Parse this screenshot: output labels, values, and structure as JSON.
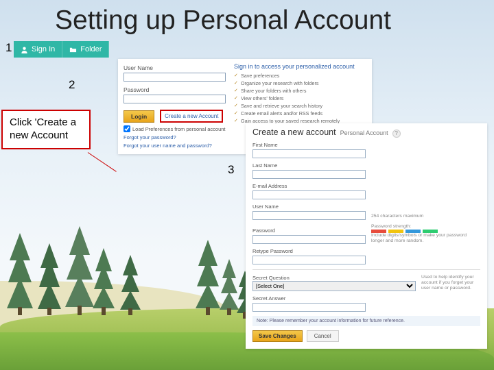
{
  "title": "Setting up Personal Account",
  "steps": {
    "one": "1",
    "two": "2",
    "three": "3"
  },
  "callout": {
    "text": "Click 'Create a new Account"
  },
  "toolbar": {
    "signin": "Sign In",
    "folder": "Folder"
  },
  "login": {
    "user_label": "User Name",
    "pass_label": "Password",
    "login_btn": "Login",
    "create_link": "Create a new Account",
    "load_prefs": "Load Preferences from personal account",
    "forgot_pw": "Forgot your password?",
    "forgot_both": "Forgot your user name and password?",
    "right_heading": "Sign in to access your personalized account",
    "benefits": [
      "Save preferences",
      "Organize your research with folders",
      "Share your folders with others",
      "View others' folders",
      "Save and retrieve your search history",
      "Create email alerts and/or RSS feeds",
      "Gain access to your saved research remotely"
    ]
  },
  "create": {
    "heading": "Create a new account",
    "subheading": "Personal Account",
    "help": "?",
    "first_name": "First Name",
    "last_name": "Last Name",
    "email": "E-mail Address",
    "username": "User Name",
    "username_note": "254 characters maximum",
    "password": "Password",
    "strength_label": "Password strength:",
    "password_note": "Include digits/symbols or make your password longer and more random.",
    "retype": "Retype Password",
    "secret_q": "Secret Question",
    "select_one": "[Select One]",
    "secret_q_note": "Used to help identify your account if you forget your user name or password.",
    "secret_a": "Secret Answer",
    "notebar": "Note: Please remember your account information for future reference.",
    "save": "Save Changes",
    "cancel": "Cancel"
  }
}
